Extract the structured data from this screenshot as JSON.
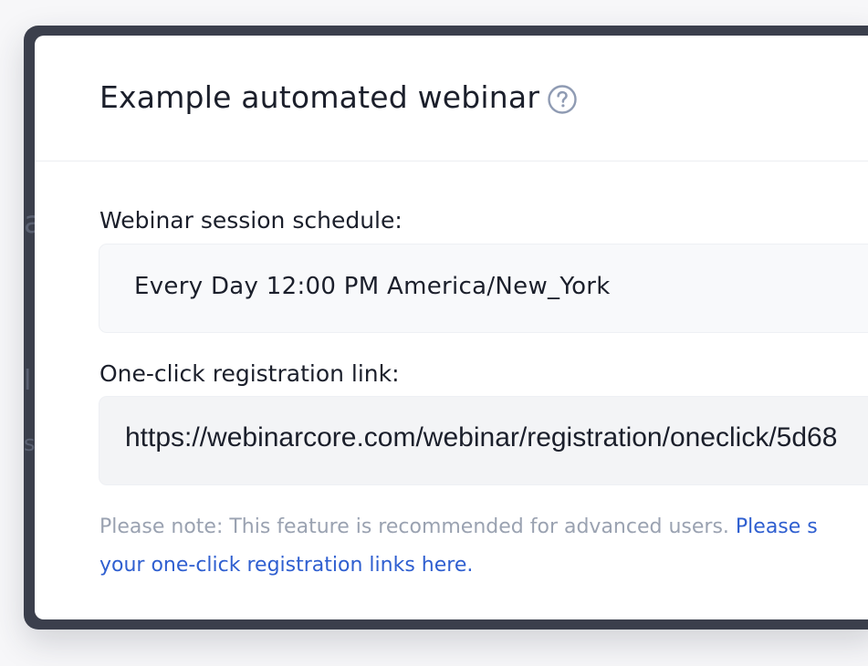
{
  "modal": {
    "title": "Example automated webinar",
    "help_icon": "question-circle-icon",
    "schedule_label": "Webinar session schedule:",
    "schedule_value": "Every Day 12:00 PM America/New_York",
    "link_label": "One-click registration link:",
    "link_value": "https://webinarcore.com/webinar/registration/oneclick/5d68",
    "note_text": "Please note: This feature is recommended for advanced users. ",
    "note_link_line1": "Please s",
    "note_link_line2": "your one-click registration links here."
  },
  "colors": {
    "backdrop": "#3b3f4c",
    "accent_link": "#2f5fd0",
    "muted_text": "#9aa2b1",
    "help_icon": "#8f9bb3"
  }
}
